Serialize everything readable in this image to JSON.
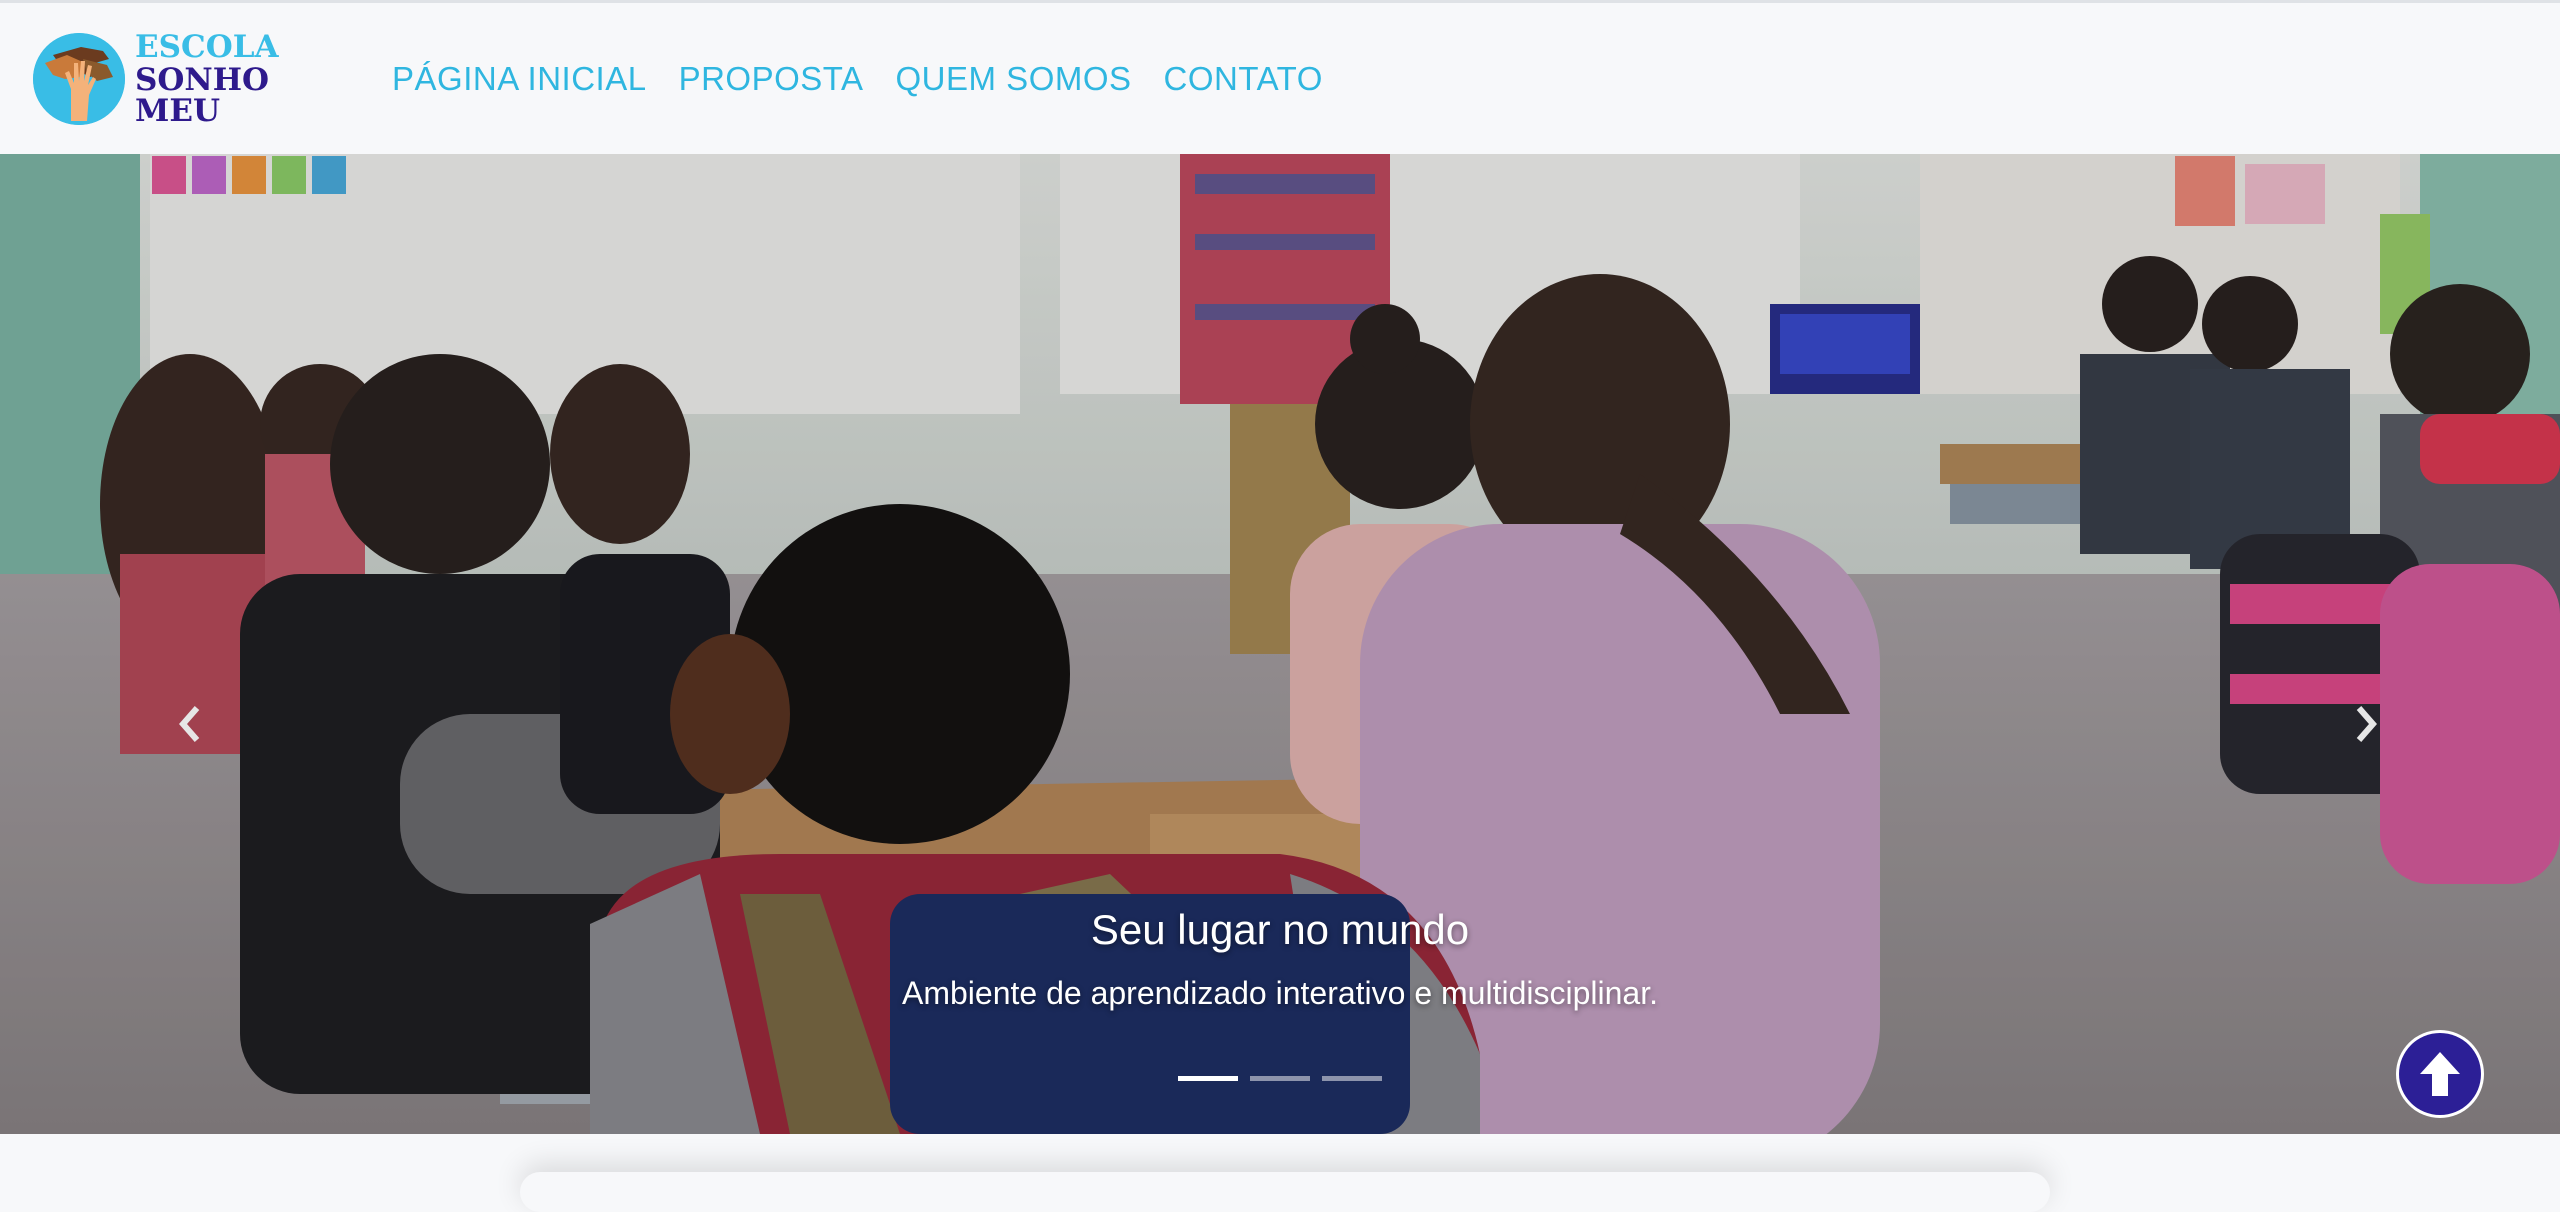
{
  "brand": {
    "line1": "ESCOLA",
    "line2": "SONHO MEU",
    "icon": "hands-logo-icon",
    "colors": {
      "light": "#39bde6",
      "dark": "#2e1a8c"
    }
  },
  "nav": {
    "items": [
      {
        "label": "PÁGINA INICIAL"
      },
      {
        "label": "PROPOSTA"
      },
      {
        "label": "QUEM SOMOS"
      },
      {
        "label": "CONTATO"
      }
    ],
    "color": "#2fb6e0"
  },
  "carousel": {
    "slide_title": "Seu lugar no mundo",
    "slide_subtitle": "Ambiente de aprendizado interativo e multidisciplinar.",
    "slide_count": 3,
    "active_slide": 1,
    "prev_icon": "chevron-left-icon",
    "next_icon": "chevron-right-icon"
  },
  "back_to_top": {
    "icon": "arrow-up-icon",
    "color": "#2c1f96"
  }
}
